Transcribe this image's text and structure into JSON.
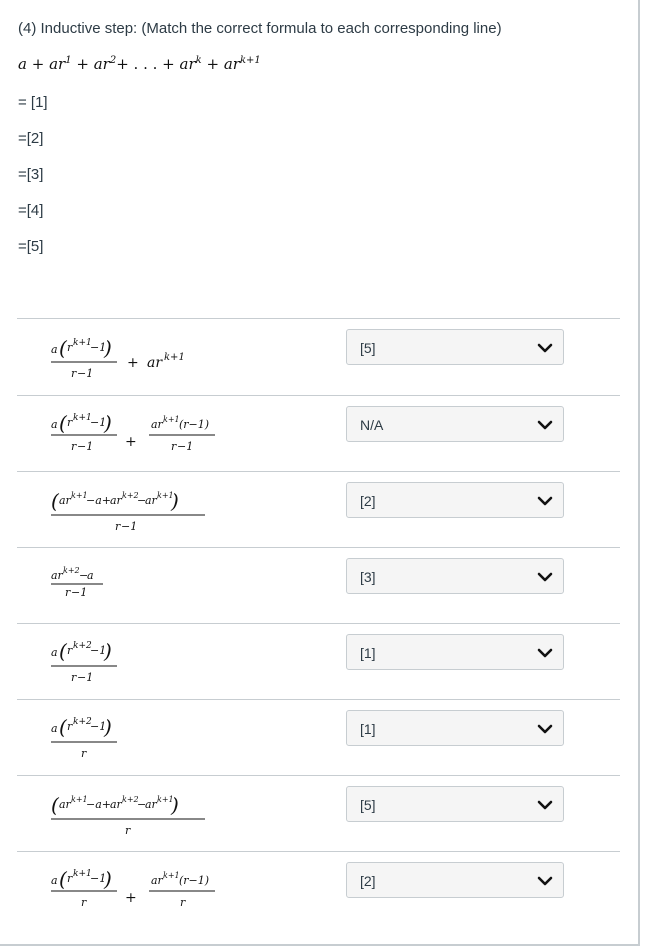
{
  "question": {
    "title": "(4) Inductive step: (Match the correct formula to each corresponding line)",
    "steps": [
      "= [1]",
      "=[2]",
      "=[3]",
      "=[4]",
      "=[5]"
    ]
  },
  "answers": [
    {
      "selected": "[5]"
    },
    {
      "selected": "N/A"
    },
    {
      "selected": "[2]"
    },
    {
      "selected": "[3]"
    },
    {
      "selected": "[1]"
    },
    {
      "selected": "[1]"
    },
    {
      "selected": "[5]"
    },
    {
      "selected": "[2]"
    }
  ],
  "icons": {
    "dropdown": "chevron-down-icon"
  }
}
